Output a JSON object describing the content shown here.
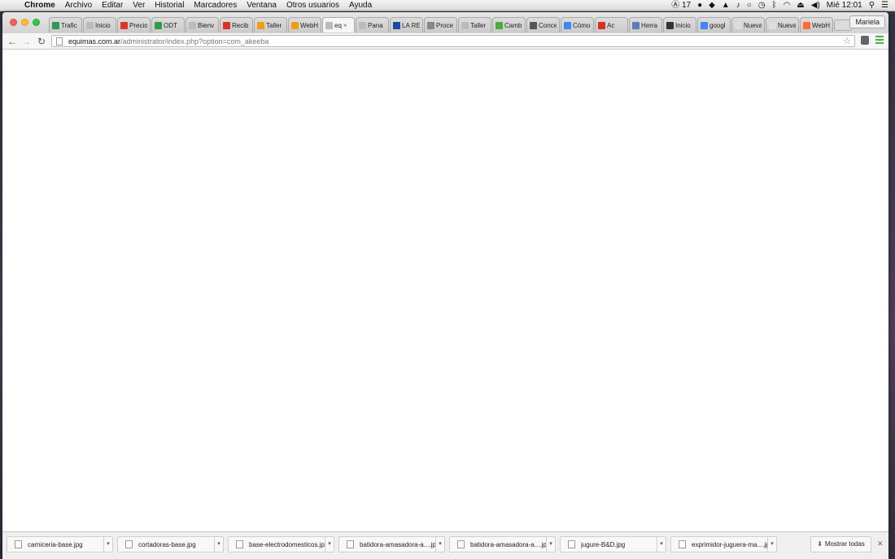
{
  "menubar": {
    "apple": "",
    "app_name": "Chrome",
    "menus": [
      "Archivo",
      "Editar",
      "Ver",
      "Historial",
      "Marcadores",
      "Ventana",
      "Otros usuarios",
      "Ayuda"
    ],
    "status": {
      "adobe_count": "17",
      "clock": "Mié 12:01"
    }
  },
  "tabs": [
    {
      "label": "Trafic",
      "icon": "sheets-icon",
      "color": "#2e9b4f"
    },
    {
      "label": "Inicio",
      "icon": "page-icon",
      "color": "#bbbbbb"
    },
    {
      "label": "Precio",
      "icon": "adobe-icon",
      "color": "#e0342b"
    },
    {
      "label": "ODT",
      "icon": "sheets-icon",
      "color": "#2e9b4f"
    },
    {
      "label": "Bienv",
      "icon": "page-icon",
      "color": "#bbbbbb"
    },
    {
      "label": "Recib",
      "icon": "gmail-icon",
      "color": "#d93025"
    },
    {
      "label": "Taller",
      "icon": "d-icon",
      "color": "#f39c12"
    },
    {
      "label": "WebH",
      "icon": "d-icon",
      "color": "#f39c12"
    },
    {
      "label": "eq",
      "icon": "page-icon",
      "color": "#bbbbbb",
      "active": true
    },
    {
      "label": "Pana",
      "icon": "page-icon",
      "color": "#bbbbbb"
    },
    {
      "label": "LA RE",
      "icon": "la-icon",
      "color": "#1b4aa0"
    },
    {
      "label": "Proce",
      "icon": "globe-icon",
      "color": "#888888"
    },
    {
      "label": "Taller",
      "icon": "page-icon",
      "color": "#bbbbbb"
    },
    {
      "label": "Camb",
      "icon": "movistar-icon",
      "color": "#45b035"
    },
    {
      "label": "Conce",
      "icon": "conce-icon",
      "color": "#555555"
    },
    {
      "label": "Cómo",
      "icon": "google-icon",
      "color": "#4285f4"
    },
    {
      "label": "Ac",
      "icon": "mic-icon",
      "color": "#d93025"
    },
    {
      "label": "Herra",
      "icon": "tool-icon",
      "color": "#5b7fb5"
    },
    {
      "label": "Inicio",
      "icon": "x-icon",
      "color": "#333333"
    },
    {
      "label": "googl",
      "icon": "google-icon",
      "color": "#4285f4"
    },
    {
      "label": "Nueva p",
      "icon": "",
      "color": "#dddddd"
    },
    {
      "label": "Nueva p",
      "icon": "",
      "color": "#dddddd"
    },
    {
      "label": "WebH",
      "icon": "cp-icon",
      "color": "#ff6c2c"
    }
  ],
  "profile_button": "Mariela",
  "omnibox": {
    "host": "equimas.com.ar",
    "path": "/administrator/index.php?option=com_akeeba"
  },
  "downloads": [
    {
      "file": "carniceria-base.jpg"
    },
    {
      "file": "cortadoras-base.jpg"
    },
    {
      "file": "base-electrodomesticos.jpg"
    },
    {
      "file": "batidora-amasadora-a....jpg"
    },
    {
      "file": "batidora-amasadora-a....jpg"
    },
    {
      "file": "jugure-B&D.jpg"
    },
    {
      "file": "exprimidor-juguera-ma....jpg"
    }
  ],
  "show_all_label": "Mostrar todas"
}
